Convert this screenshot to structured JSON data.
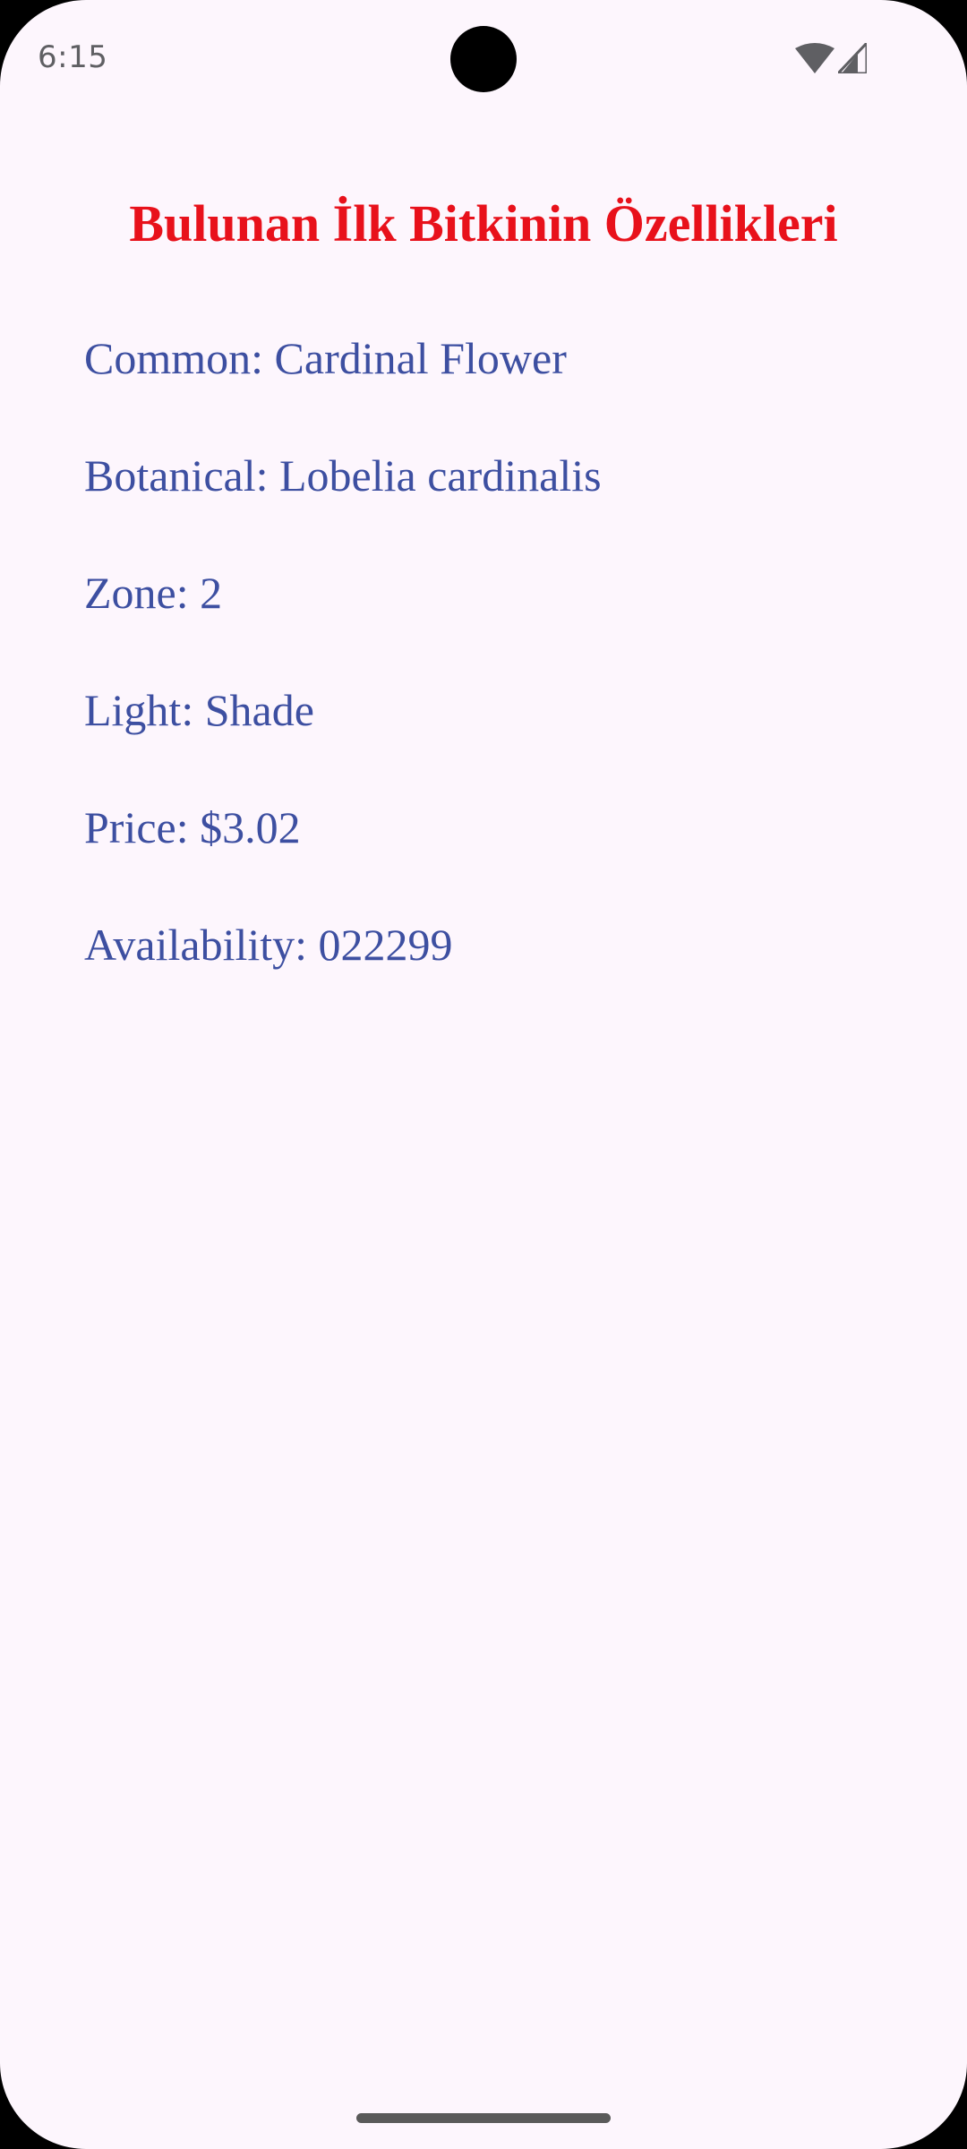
{
  "status_bar": {
    "time": "6:15",
    "icons": [
      "wifi-icon",
      "cellular-signal-icon"
    ]
  },
  "screen": {
    "title": "Bulunan İlk Bitkinin Özellikleri",
    "details": [
      "Common: Cardinal Flower",
      "Botanical: Lobelia cardinalis",
      "Zone: 2",
      "Light: Shade",
      "Price: $3.02",
      "Availability: 022299"
    ]
  },
  "colors": {
    "background": "#fdf6fd",
    "title": "#e8111b",
    "detail_text": "#3d4fa1",
    "status_text": "#5f5f63"
  }
}
